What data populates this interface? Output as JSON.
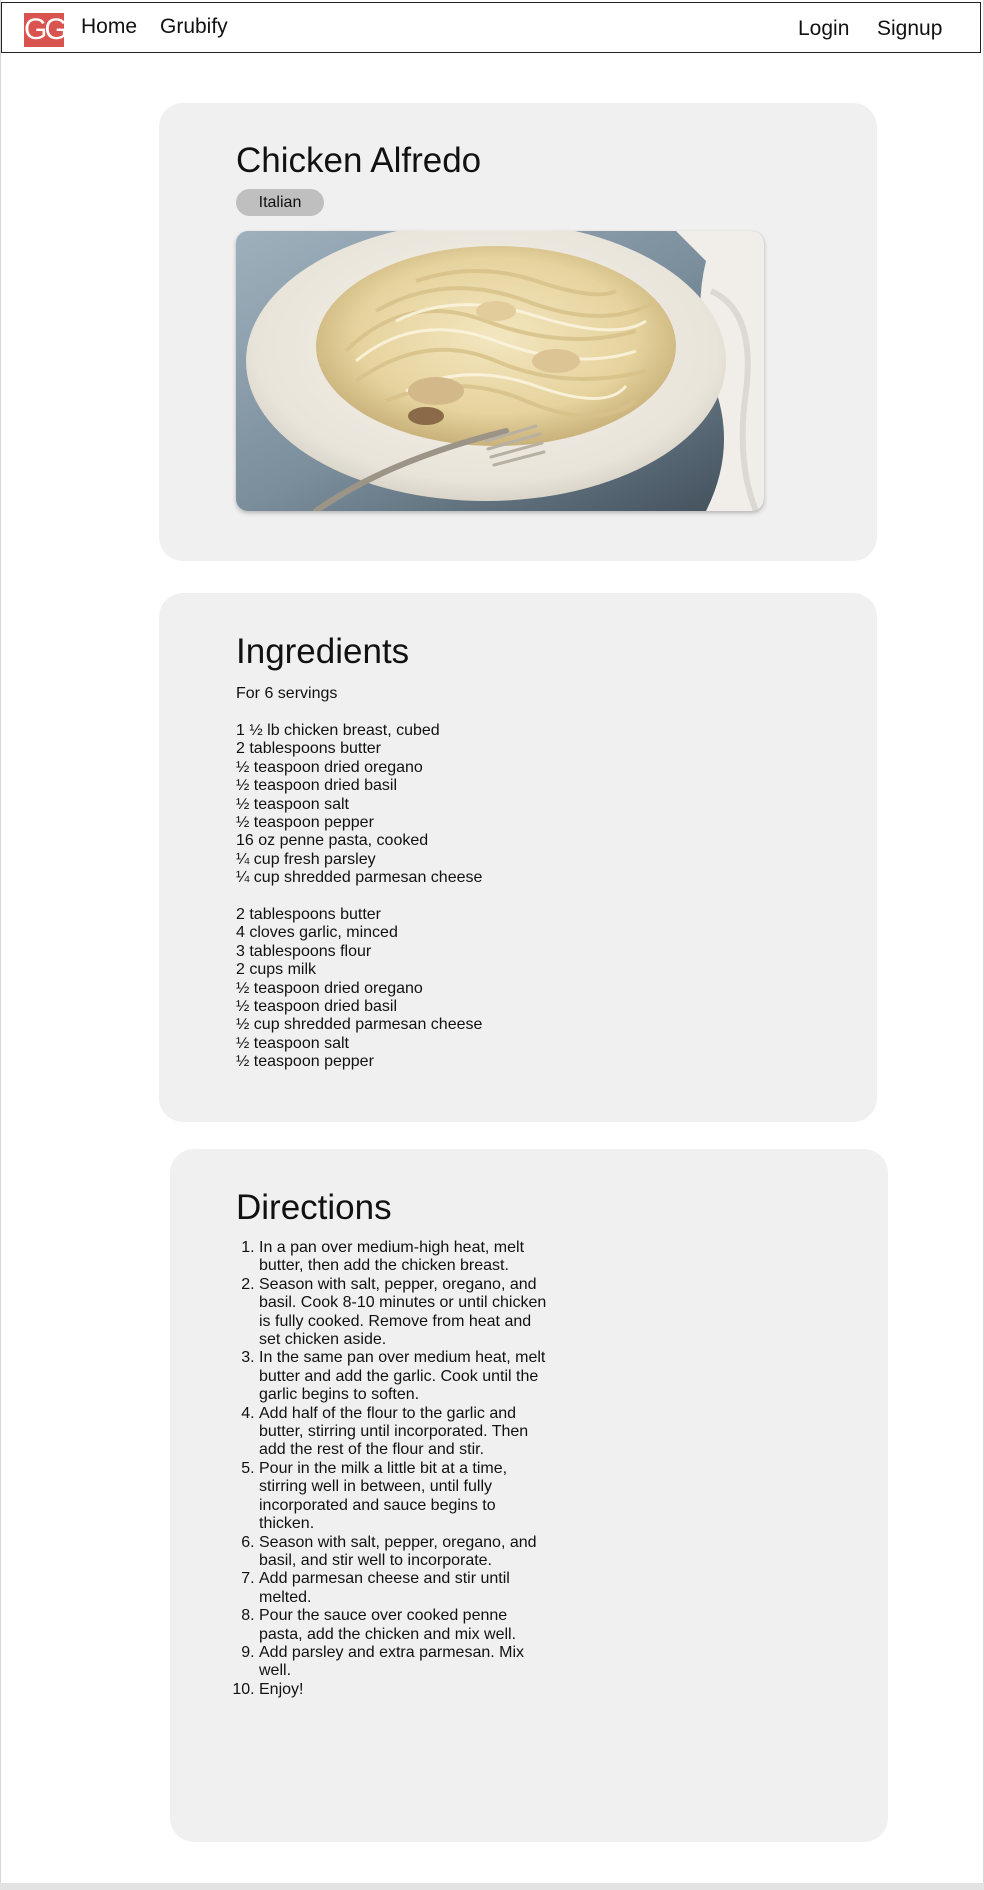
{
  "navbar": {
    "logo_text": "GG",
    "home_label": "Home",
    "brand_label": "Grubify",
    "login_label": "Login",
    "signup_label": "Signup",
    "logo_color": "#d9534f"
  },
  "recipe": {
    "title": "Chicken Alfredo",
    "cuisine": "Italian",
    "image_icon": "pasta-dish-photo"
  },
  "ingredients": {
    "heading": "Ingredients",
    "servings": "For 6 servings",
    "group_1": [
      "1 ½ lb chicken breast, cubed",
      "2 tablespoons butter",
      "½ teaspoon dried oregano",
      "½ teaspoon dried basil",
      "½ teaspoon salt",
      "½ teaspoon pepper",
      "16 oz penne pasta, cooked",
      "¼ cup fresh parsley",
      "¼ cup shredded parmesan cheese"
    ],
    "group_2": [
      "2 tablespoons butter",
      "4 cloves garlic, minced",
      "3 tablespoons flour",
      "2 cups milk",
      "½ teaspoon dried oregano",
      "½ teaspoon dried basil",
      "½ cup shredded parmesan cheese",
      "½ teaspoon salt",
      "½ teaspoon pepper"
    ]
  },
  "directions": {
    "heading": "Directions",
    "steps": [
      "In a pan over medium-high heat, melt butter, then add the chicken breast.",
      "Season with salt, pepper, oregano, and basil. Cook 8-10 minutes or until chicken is fully cooked. Remove from heat and set chicken aside.",
      "In the same pan over medium heat, melt butter and add the garlic. Cook until the garlic begins to soften.",
      "Add half of the flour to the garlic and butter, stirring until incorporated. Then add the rest of the flour and stir.",
      "Pour in the milk a little bit at a time, stirring well in between, until fully incorporated and sauce begins to thicken.",
      "Season with salt, pepper, oregano, and basil, and stir well to incorporate.",
      "Add parmesan cheese and stir until melted.",
      "Pour the sauce over cooked penne pasta, add the chicken and mix well.",
      "Add parsley and extra parmesan. Mix well.",
      "Enjoy!"
    ]
  }
}
